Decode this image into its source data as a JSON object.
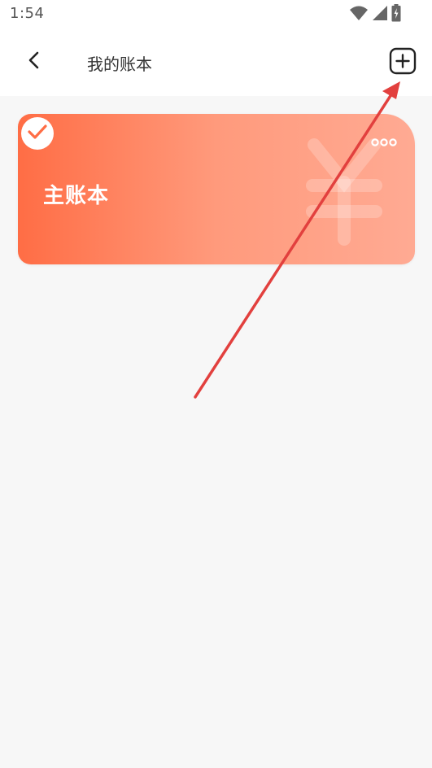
{
  "status_bar": {
    "time": "1:54",
    "icons": [
      "wifi-icon",
      "signal-icon",
      "battery-icon"
    ]
  },
  "header": {
    "title": "我的账本",
    "back_icon": "chevron-left-icon",
    "add_icon": "add-square-icon"
  },
  "accounts": [
    {
      "name": "主账本",
      "selected": true,
      "icons": [
        "check-icon",
        "more-icon",
        "yen-icon"
      ]
    }
  ],
  "colors": {
    "card_gradient_start": "#ff6d45",
    "card_gradient_end": "#ffaa93",
    "check_color": "#ff6d45",
    "annotation_arrow": "#e2403e",
    "background": "#f7f7f7"
  }
}
